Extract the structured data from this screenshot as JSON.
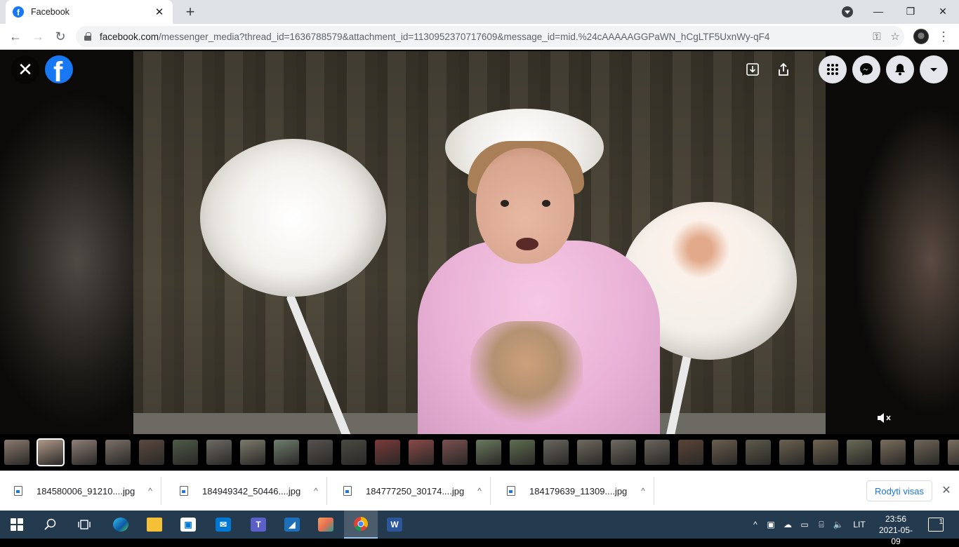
{
  "browser": {
    "tab_title": "Facebook",
    "tab_icon": "facebook-icon",
    "tab_close": "✕",
    "new_tab": "+",
    "url_host": "facebook.com",
    "url_path": "/messenger_media?thread_id=1636788579&attachment_id=1130952370717609&message_id=mid.%24cAAAAAGGPaWN_hCgLTF5UxnWy-qF4",
    "window_buttons": {
      "minimize": "—",
      "restore": "❐",
      "close": "✕"
    },
    "nav": {
      "back": "←",
      "forward": "→",
      "reload": "↻"
    },
    "omnibox_icons": {
      "key": "⚿",
      "star": "☆"
    },
    "menu": "⋮"
  },
  "viewer": {
    "close": "✕",
    "logo": "f",
    "toolbar": {
      "expand": "⤓",
      "share": "⇪"
    },
    "header_buttons": {
      "menu": "⋮⋮⋮",
      "messenger": "✉",
      "notifications": "🔔",
      "account": "▾"
    },
    "mute": "🔇",
    "thumbnail_count": 29,
    "active_thumbnail": 1
  },
  "downloads": {
    "items": [
      {
        "name": "184580006_91210....jpg"
      },
      {
        "name": "184949342_50446....jpg"
      },
      {
        "name": "184777250_30174....jpg"
      },
      {
        "name": "184179639_11309....jpg"
      }
    ],
    "caret": "^",
    "show_all": "Rodyti visas",
    "close": "✕"
  },
  "taskbar": {
    "language": "LIT",
    "time": "23:56",
    "date": "2021-05-09",
    "notifications_count": "1",
    "tray_chevron": "^"
  },
  "colors": {
    "facebook_blue": "#1877f2",
    "taskbar": "#243a4e",
    "link_blue": "#1a73e8"
  }
}
